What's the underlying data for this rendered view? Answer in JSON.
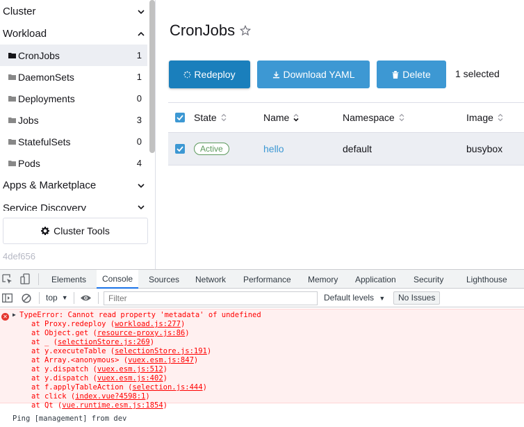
{
  "sidebar": {
    "groups": [
      {
        "label": "Cluster",
        "chevron": "chevron-down"
      },
      {
        "label": "Workload",
        "chevron": "chevron-up"
      },
      {
        "label": "Apps & Marketplace",
        "chevron": "chevron-down"
      },
      {
        "label": "Service Discovery",
        "chevron": "chevron-down"
      }
    ],
    "items": [
      {
        "label": "CronJobs",
        "count": "1",
        "active": true
      },
      {
        "label": "DaemonSets",
        "count": "1"
      },
      {
        "label": "Deployments",
        "count": "0"
      },
      {
        "label": "Jobs",
        "count": "3"
      },
      {
        "label": "StatefulSets",
        "count": "0"
      },
      {
        "label": "Pods",
        "count": "4"
      }
    ],
    "cluster_tools_label": "Cluster Tools",
    "version": "4def656"
  },
  "main": {
    "title": "CronJobs",
    "buttons": {
      "redeploy": "Redeploy",
      "download_yaml": "Download YAML",
      "delete": "Delete"
    },
    "selected_text": "1 selected",
    "table": {
      "columns": [
        "State",
        "Name",
        "Namespace",
        "Image"
      ],
      "rows": [
        {
          "state": "Active",
          "name": "hello",
          "namespace": "default",
          "image": "busybox",
          "checked": true
        }
      ]
    }
  },
  "devtools": {
    "tabs": [
      "Elements",
      "Console",
      "Sources",
      "Network",
      "Performance",
      "Memory",
      "Application",
      "Security",
      "Lighthouse"
    ],
    "active_tab": "Console",
    "context": "top",
    "filter_placeholder": "Filter",
    "levels": "Default levels",
    "issues": "No Issues",
    "error": {
      "message": "TypeError: Cannot read property 'metadata' of undefined",
      "stack": [
        {
          "at": "at Proxy.redeploy (",
          "src": "workload.js:277",
          "end": ")"
        },
        {
          "at": "at Object.get (",
          "src": "resource-proxy.js:86",
          "end": ")"
        },
        {
          "at": "at _ (",
          "src": "selectionStore.js:269",
          "end": ")"
        },
        {
          "at": "at y.executeTable (",
          "src": "selectionStore.js:191",
          "end": ")"
        },
        {
          "at": "at Array.<anonymous> (",
          "src": "vuex.esm.js:847",
          "end": ")"
        },
        {
          "at": "at y.dispatch (",
          "src": "vuex.esm.js:512",
          "end": ")"
        },
        {
          "at": "at y.dispatch (",
          "src": "vuex.esm.js:402",
          "end": ")"
        },
        {
          "at": "at f.applyTableAction (",
          "src": "selection.js:444",
          "end": ")"
        },
        {
          "at": "at click (",
          "src": "index.vue?4598:1",
          "end": ")"
        },
        {
          "at": "at Qt (",
          "src": "vue.runtime.esm.js:1854",
          "end": ")"
        }
      ]
    },
    "log": "Ping [management] from dev"
  },
  "colors": {
    "primary": "#1a7fbc",
    "button": "#3d98d3",
    "active_badge": "#5d995d",
    "error_text": "#ff0000",
    "error_bg": "#fff0f0"
  }
}
